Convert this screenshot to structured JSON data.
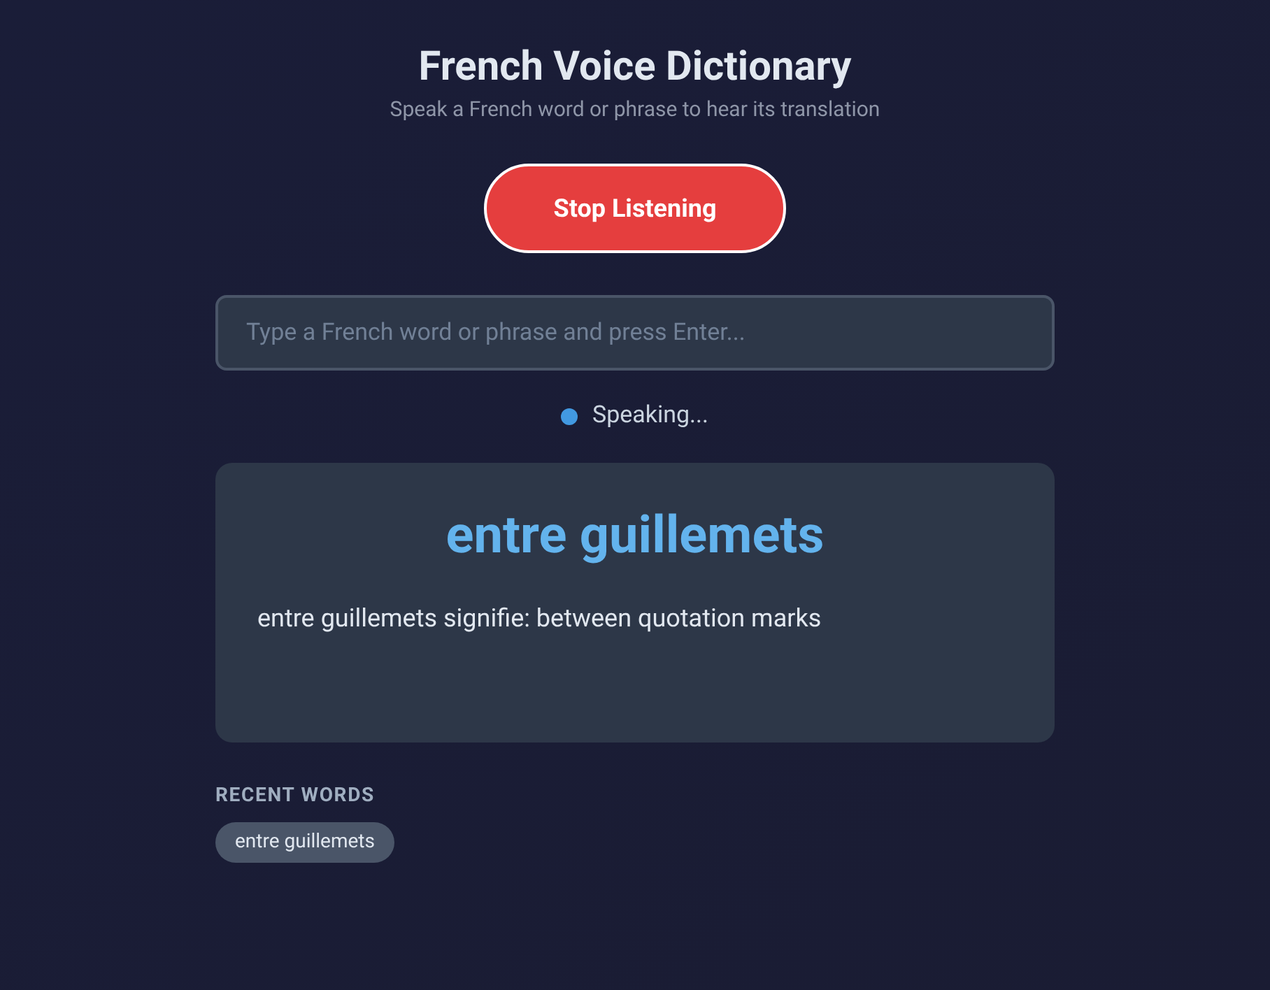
{
  "header": {
    "title": "French Voice Dictionary",
    "subtitle": "Speak a French word or phrase to hear its translation"
  },
  "listen_button": {
    "label": "Stop Listening"
  },
  "search": {
    "placeholder": "Type a French word or phrase and press Enter..."
  },
  "status": {
    "text": "Speaking..."
  },
  "result": {
    "word": "entre guillemets",
    "translation": "entre guillemets signifie: between quotation marks"
  },
  "recent": {
    "heading": "RECENT WORDS",
    "words": [
      "entre guillemets"
    ]
  }
}
